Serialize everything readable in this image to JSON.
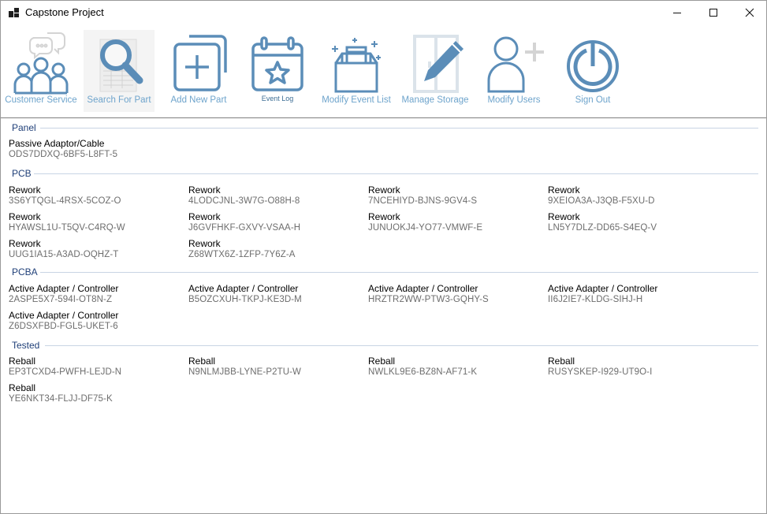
{
  "window": {
    "title": "Capstone Project"
  },
  "toolbar": [
    {
      "key": "customer_service",
      "label": "Customer Service",
      "icon": "customer-service-icon"
    },
    {
      "key": "search_for_part",
      "label": "Search For Part",
      "icon": "search-icon"
    },
    {
      "key": "add_new_part",
      "label": "Add New Part",
      "icon": "add-part-icon"
    },
    {
      "key": "event_log",
      "label": "Event Log",
      "icon": "calendar-icon"
    },
    {
      "key": "modify_event_list",
      "label": "Modify Event List",
      "icon": "box-icon"
    },
    {
      "key": "manage_storage",
      "label": "Manage Storage",
      "icon": "edit-storage-icon"
    },
    {
      "key": "modify_users",
      "label": "Modify Users",
      "icon": "add-user-icon"
    },
    {
      "key": "sign_out",
      "label": "Sign Out",
      "icon": "power-icon"
    }
  ],
  "colors": {
    "accent": "#5b8db8",
    "label": "#6ea4cc",
    "group_header": "#1f3f78"
  },
  "groups": [
    {
      "header": "Panel",
      "items": [
        {
          "name": "Passive Adaptor/Cable",
          "code": "ODS7DDXQ-6BF5-L8FT-5"
        }
      ]
    },
    {
      "header": "PCB",
      "items": [
        {
          "name": "Rework",
          "code": "3S6YTQGL-4RSX-5COZ-O"
        },
        {
          "name": "Rework",
          "code": "4LODCJNL-3W7G-O88H-8"
        },
        {
          "name": "Rework",
          "code": "7NCEHIYD-BJNS-9GV4-S"
        },
        {
          "name": "Rework",
          "code": "9XEIOA3A-J3QB-F5XU-D"
        },
        {
          "name": "Rework",
          "code": "HYAWSL1U-T5QV-C4RQ-W"
        },
        {
          "name": "Rework",
          "code": "J6GVFHKF-GXVY-VSAA-H"
        },
        {
          "name": "Rework",
          "code": "JUNUOKJ4-YO77-VMWF-E"
        },
        {
          "name": "Rework",
          "code": "LN5Y7DLZ-DD65-S4EQ-V"
        },
        {
          "name": "Rework",
          "code": "UUG1IA15-A3AD-OQHZ-T"
        },
        {
          "name": "Rework",
          "code": "Z68WTX6Z-1ZFP-7Y6Z-A"
        }
      ]
    },
    {
      "header": "PCBA",
      "items": [
        {
          "name": "Active Adapter / Controller",
          "code": "2ASPE5X7-594I-OT8N-Z"
        },
        {
          "name": "Active Adapter / Controller",
          "code": "B5OZCXUH-TKPJ-KE3D-M"
        },
        {
          "name": "Active Adapter / Controller",
          "code": "HRZTR2WW-PTW3-GQHY-S"
        },
        {
          "name": "Active Adapter / Controller",
          "code": "II6J2IE7-KLDG-SIHJ-H"
        },
        {
          "name": "Active Adapter / Controller",
          "code": "Z6DSXFBD-FGL5-UKET-6"
        }
      ]
    },
    {
      "header": "Tested",
      "items": [
        {
          "name": "Reball",
          "code": "EP3TCXD4-PWFH-LEJD-N"
        },
        {
          "name": "Reball",
          "code": "N9NLMJBB-LYNE-P2TU-W"
        },
        {
          "name": "Reball",
          "code": "NWLKL9E6-BZ8N-AF71-K"
        },
        {
          "name": "Reball",
          "code": "RUSYSKEP-I929-UT9O-I"
        },
        {
          "name": "Reball",
          "code": "YE6NKT34-FLJJ-DF75-K"
        }
      ]
    }
  ]
}
